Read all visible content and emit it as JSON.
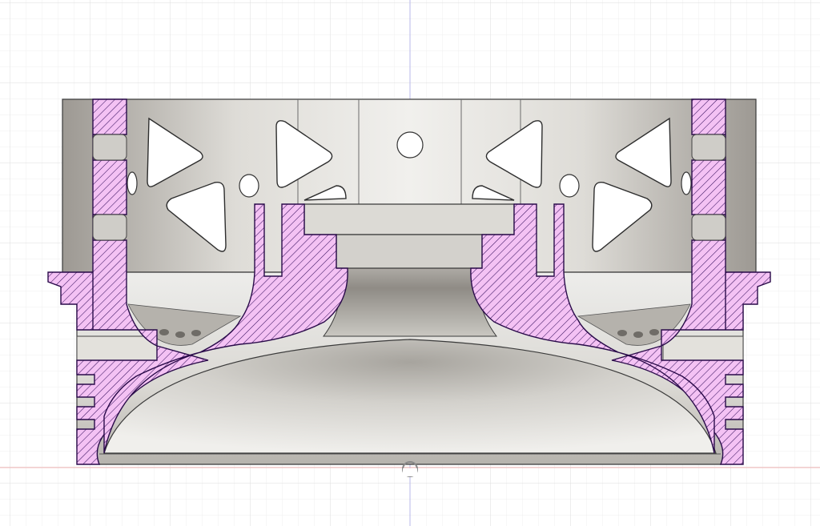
{
  "viewport": {
    "view": "section-analysis",
    "grid": true
  },
  "colors": {
    "background": "#ffffff",
    "grid_minor": "#eeeeee",
    "grid_major": "#dcdcdc",
    "axis_vertical": "#b7b7ea",
    "axis_horizontal": "#f2b3b3",
    "section_fill": "#f4c2f4",
    "hatch_line": "#2a0b4a",
    "body_light": "#ececea",
    "body_mid": "#cfcdc8",
    "body_dark": "#8f8b85",
    "outline": "#3a3a3a"
  },
  "icons": {
    "origin_marker": "origin-marker-icon"
  }
}
